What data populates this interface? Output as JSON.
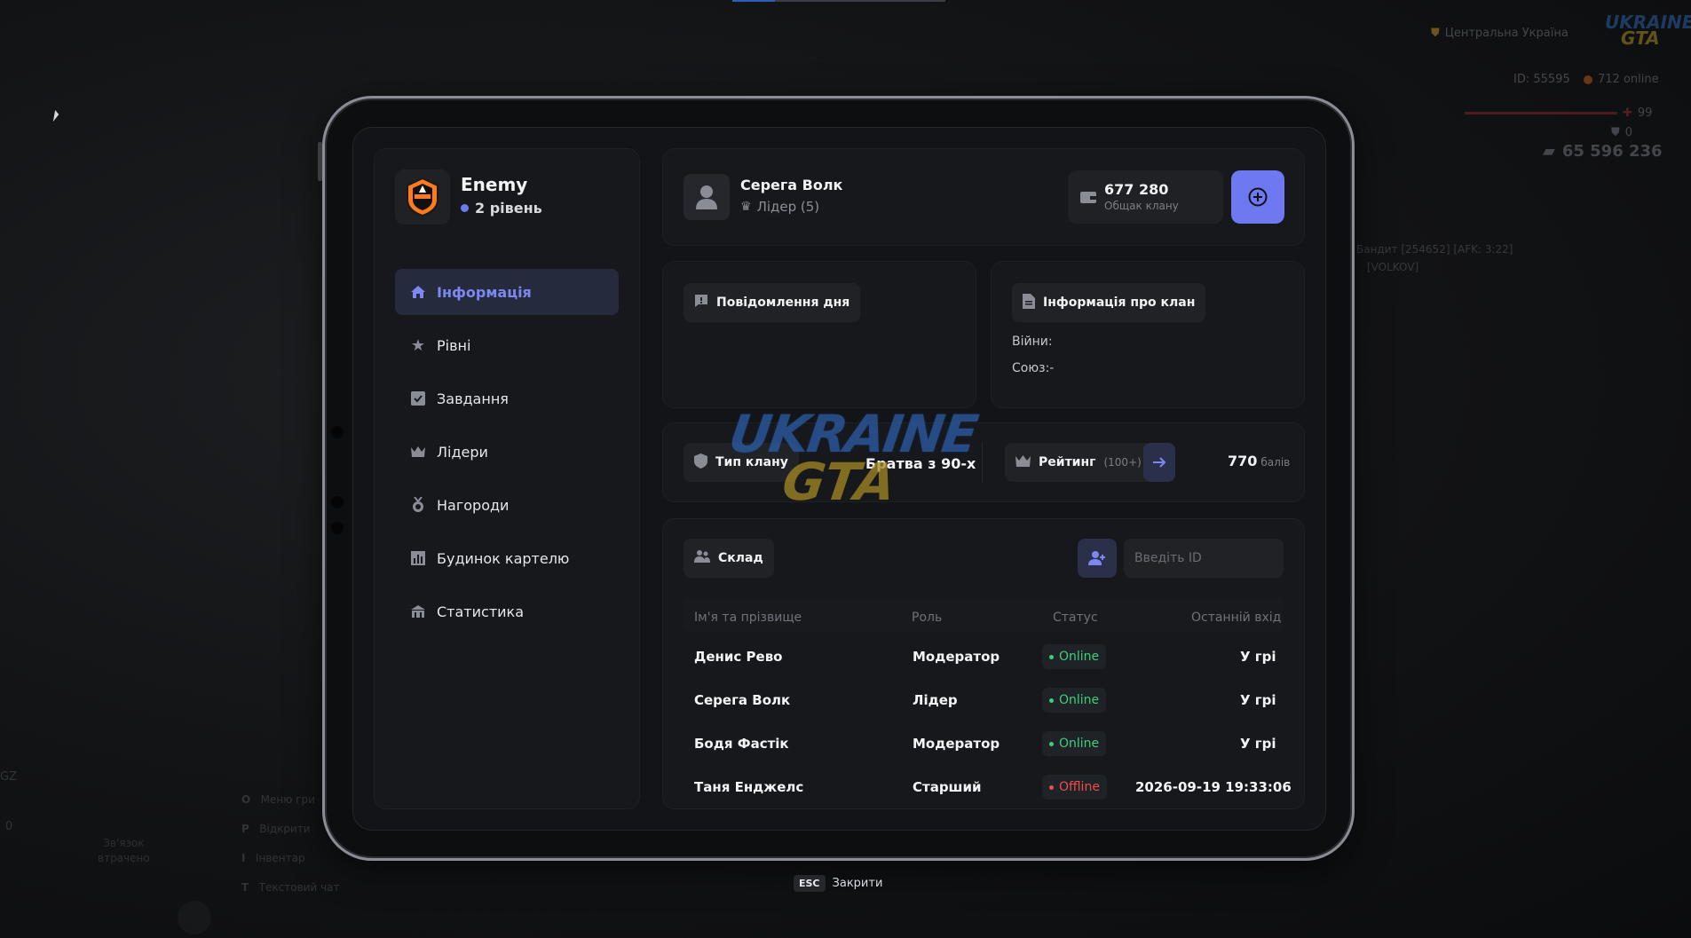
{
  "hud": {
    "region": "Центральна Україна",
    "logo_line1": "UKRAINE",
    "logo_line2": "GTA",
    "id_text": "ID: 55595",
    "online_text": "712 online",
    "health": "99",
    "armor": "0",
    "money": "65 596 236",
    "player_tag_1": "Бандит [254652] [AFK: 3:22]",
    "player_tag_2": "[VOLKOV]",
    "hotkeys": [
      {
        "key": "O",
        "label": "Меню гри"
      },
      {
        "key": "P",
        "label": "Відкрити"
      },
      {
        "key": "I",
        "label": "Інвентар"
      },
      {
        "key": "T",
        "label": "Текстовий чат"
      }
    ],
    "left_gz": "GZ",
    "left_zero": "0",
    "voice_line1": "Зв'язок",
    "voice_line2": "втрачено"
  },
  "clan": {
    "name": "Enemy",
    "level": "2 рівень"
  },
  "nav": {
    "items": [
      {
        "label": "Інформація",
        "icon": "home-icon"
      },
      {
        "label": "Рівні",
        "icon": "star-icon"
      },
      {
        "label": "Завдання",
        "icon": "checkbox-icon"
      },
      {
        "label": "Лідери",
        "icon": "crown-icon"
      },
      {
        "label": "Нагороди",
        "icon": "medal-icon"
      },
      {
        "label": "Будинок картелю",
        "icon": "building-icon"
      },
      {
        "label": "Статистика",
        "icon": "stats-icon"
      }
    ]
  },
  "user": {
    "name": "Серега Волк",
    "role": "Лідер (5)"
  },
  "bank": {
    "amount": "677 280",
    "label": "Общак клану"
  },
  "motd": {
    "title": "Повідомлення дня"
  },
  "clan_info": {
    "title": "Інформація про клан",
    "wars_label": "Війни:",
    "union_label": "Союз:-"
  },
  "clan_type": {
    "label": "Тип клану",
    "value": "Братва з 90-х"
  },
  "rating": {
    "label": "Рейтинг",
    "hint": "(100+)",
    "points": "770",
    "unit": "балів"
  },
  "warehouse": {
    "label": "Склад",
    "id_placeholder": "Введіть ID"
  },
  "members": {
    "headers": [
      "Ім'я та прізвище",
      "Роль",
      "Статус",
      "Останній вхід"
    ],
    "rows": [
      {
        "name": "Денис Рево",
        "role": "Модератор",
        "status": "Online",
        "last": "У грі"
      },
      {
        "name": "Серега Волк",
        "role": "Лідер",
        "status": "Online",
        "last": "У грі"
      },
      {
        "name": "Бодя Фастік",
        "role": "Модератор",
        "status": "Online",
        "last": "У грі"
      },
      {
        "name": "Таня Енджелс",
        "role": "Старший",
        "status": "Offline",
        "last": "2026-09-19 19:33:06"
      }
    ]
  },
  "footer": {
    "key": "ESC",
    "label": "Закрити"
  },
  "colors": {
    "accent": "#6e78f0",
    "online": "#3ecf7a",
    "offline": "#ef4d4d"
  }
}
